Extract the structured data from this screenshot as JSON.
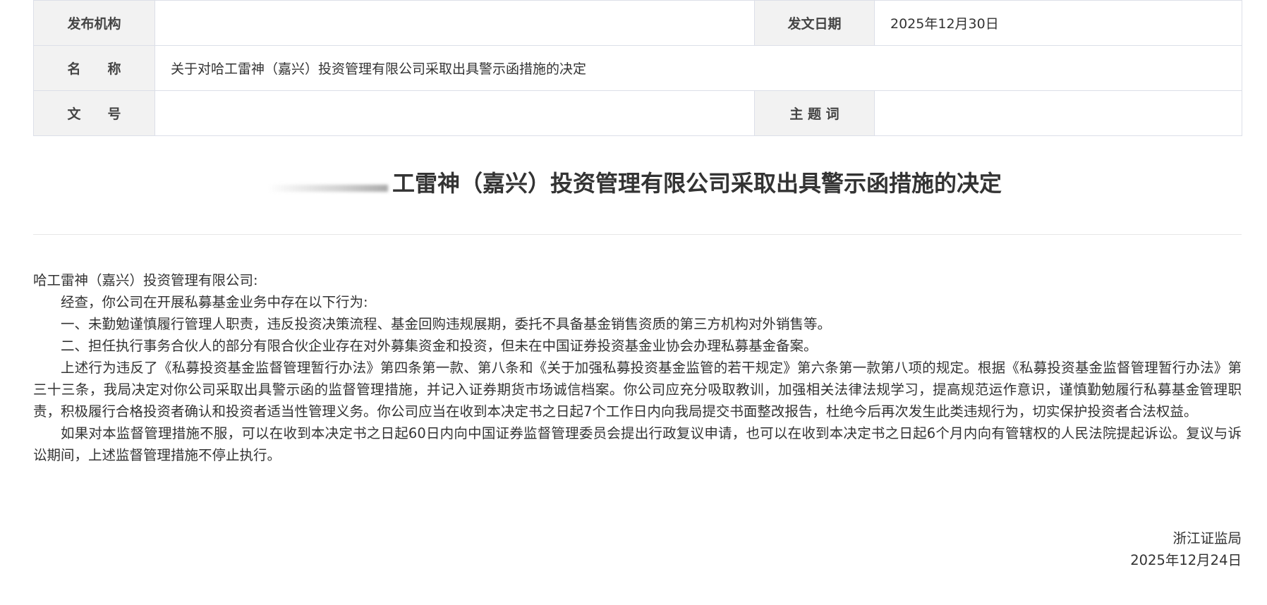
{
  "meta": {
    "issuer_label": "发布机构",
    "issuer_value": "",
    "date_label": "发文日期",
    "date_value": "2025年12月30日",
    "name_label": "名　　称",
    "name_value": "关于对哈工雷神（嘉兴）投资管理有限公司采取出具警示函措施的决定",
    "docno_label": "文　　号",
    "docno_value": "",
    "subject_label": "主 题 词",
    "subject_value": ""
  },
  "document": {
    "title_visible": "工雷神（嘉兴）投资管理有限公司采取出具警示函措施的决定",
    "addressee": "哈工雷神（嘉兴）投资管理有限公司:",
    "paragraphs": [
      "经查，你公司在开展私募基金业务中存在以下行为:",
      "一、未勤勉谨慎履行管理人职责，违反投资决策流程、基金回购违规展期，委托不具备基金销售资质的第三方机构对外销售等。",
      "二、担任执行事务合伙人的部分有限合伙企业存在对外募集资金和投资，但未在中国证券投资基金业协会办理私募基金备案。",
      "上述行为违反了《私募投资基金监督管理暂行办法》第四条第一款、第八条和《关于加强私募投资基金监管的若干规定》第六条第一款第八项的规定。根据《私募投资基金监督管理暂行办法》第三十三条，我局决定对你公司采取出具警示函的监督管理措施，并记入证券期货市场诚信档案。你公司应充分吸取教训，加强相关法律法规学习，提高规范运作意识，谨慎勤勉履行私募基金管理职责，积极履行合格投资者确认和投资者适当性管理义务。你公司应当在收到本决定书之日起7个工作日内向我局提交书面整改报告，杜绝今后再次发生此类违规行为，切实保护投资者合法权益。",
      "如果对本监督管理措施不服，可以在收到本决定书之日起60日内向中国证券监督管理委员会提出行政复议申请，也可以在收到本决定书之日起6个月内向有管辖权的人民法院提起诉讼。复议与诉讼期间，上述监督管理措施不停止执行。"
    ],
    "signature_org": "浙江证监局",
    "signature_date": "2025年12月24日"
  }
}
